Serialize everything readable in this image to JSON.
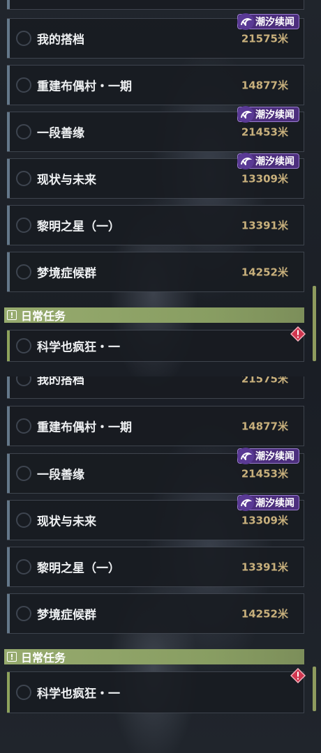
{
  "quests": [
    {
      "title": "我的搭档",
      "distance": "21575米",
      "tag": "潮汐续闻"
    },
    {
      "title": "重建布偶村・一期",
      "distance": "14877米",
      "tag": null
    },
    {
      "title": "一段善缘",
      "distance": "21453米",
      "tag": "潮汐续闻"
    },
    {
      "title": "现状与未来",
      "distance": "13309米",
      "tag": "潮汐续闻"
    },
    {
      "title": "黎明之星（一）",
      "distance": "13391米",
      "tag": null
    },
    {
      "title": "梦境症候群",
      "distance": "14252米",
      "tag": null
    }
  ],
  "daily": {
    "header": "日常任务",
    "header_icon": "exclamation-box-icon",
    "quest_title": "科学也疯狂・一",
    "alert_icon": "red-diamond-exclamation-icon"
  },
  "tag_icon": "tidal-swirl-icon",
  "colors": {
    "tag_bg": "#4c2e7d",
    "distance": "#c8b07c",
    "daily_header": "#97ab6e",
    "alert": "#d0364f"
  }
}
